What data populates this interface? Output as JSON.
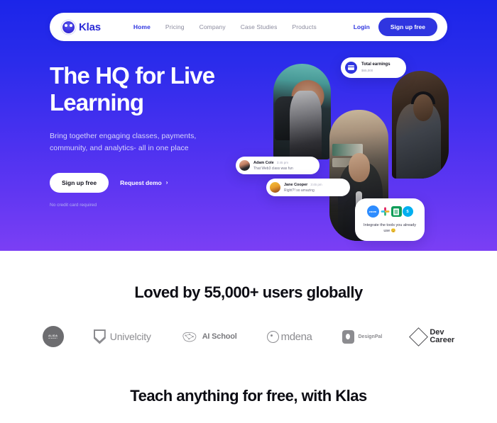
{
  "nav": {
    "brand": "Klas",
    "brand_icon": "klas-avatar-icon",
    "links": [
      {
        "label": "Home",
        "active": true
      },
      {
        "label": "Pricing",
        "active": false
      },
      {
        "label": "Company",
        "active": false
      },
      {
        "label": "Case Studies",
        "active": false
      },
      {
        "label": "Products",
        "active": false
      }
    ],
    "login_label": "Login",
    "signup_label": "Sign up free"
  },
  "hero": {
    "title": "The HQ for Live Learning",
    "subtitle": "Bring together engaging classes, payments, community, and analytics- all in one place",
    "cta_primary": "Sign up free",
    "cta_secondary": "Request demo",
    "cta_secondary_chevron": "›",
    "note": "No credit card required",
    "gradient_top": "#1B25E9",
    "gradient_bottom": "#7B3FF4",
    "accent": "#2F35E0"
  },
  "collage": {
    "earnings_card": {
      "title": "Total earnings",
      "value": "$65,000",
      "icon": "card-icon"
    },
    "chats": [
      {
        "name": "Adam Cole",
        "time": "3:45 pm",
        "message": "That Web3 class was fun"
      },
      {
        "name": "Jane Cooper",
        "time": "3:45 pm",
        "message": "Right?! so amazing"
      }
    ],
    "integrate_card": {
      "text": "Integrate the tools you already use 😊",
      "logos": [
        {
          "name": "zoom-logo",
          "label": "zoom"
        },
        {
          "name": "slack-logo",
          "label": ""
        },
        {
          "name": "google-sheets-logo",
          "label": ""
        },
        {
          "name": "skype-logo",
          "label": "S"
        }
      ]
    }
  },
  "social_proof": {
    "heading": "Loved by 55,000+ users globally",
    "logos": [
      {
        "name": "alida-logo",
        "line1": "ALIDA",
        "line2": "ACADEMY",
        "text": ""
      },
      {
        "name": "univelcity-logo",
        "text": "Univelcity"
      },
      {
        "name": "ai-school-logo",
        "text": "AI School"
      },
      {
        "name": "omdena-logo",
        "text": "mdena"
      },
      {
        "name": "designpal-logo",
        "text": "DesignPal"
      },
      {
        "name": "dev-career-logo",
        "line1": "Dev",
        "line2": "Career"
      }
    ]
  },
  "next_section": {
    "heading": "Teach anything for free, with Klas"
  }
}
